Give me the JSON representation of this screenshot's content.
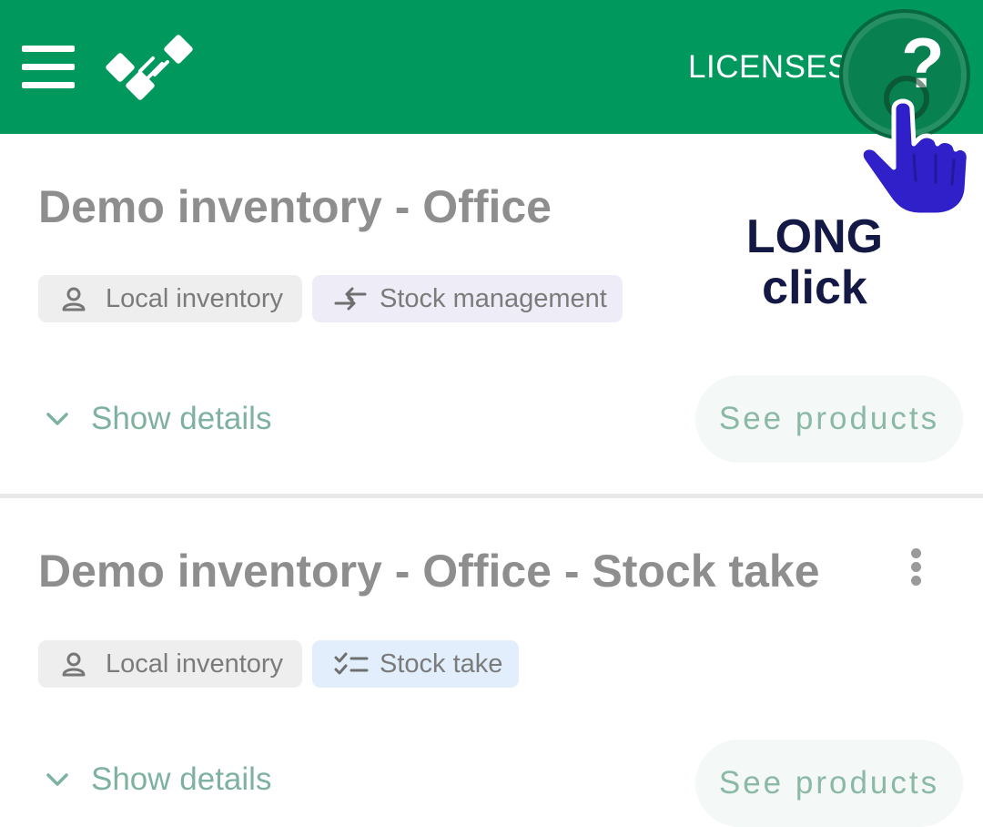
{
  "header": {
    "licenses_label": "LICENSES",
    "help_label": "?",
    "background_color": "#01985d"
  },
  "annotation": {
    "line1": "LONG",
    "line2": "click",
    "color": "#141844"
  },
  "inventories": [
    {
      "title": "Demo inventory - Office",
      "chips": [
        {
          "icon": "person-icon",
          "label": "Local inventory"
        },
        {
          "icon": "transfer-arrows-icon",
          "label": "Stock management"
        }
      ],
      "show_details_label": "Show details",
      "see_products_label": "See products"
    },
    {
      "title": "Demo inventory - Office - Stock take",
      "chips": [
        {
          "icon": "person-icon",
          "label": "Local inventory"
        },
        {
          "icon": "checklist-icon",
          "label": "Stock take"
        }
      ],
      "show_details_label": "Show details",
      "see_products_label": "See products"
    }
  ]
}
